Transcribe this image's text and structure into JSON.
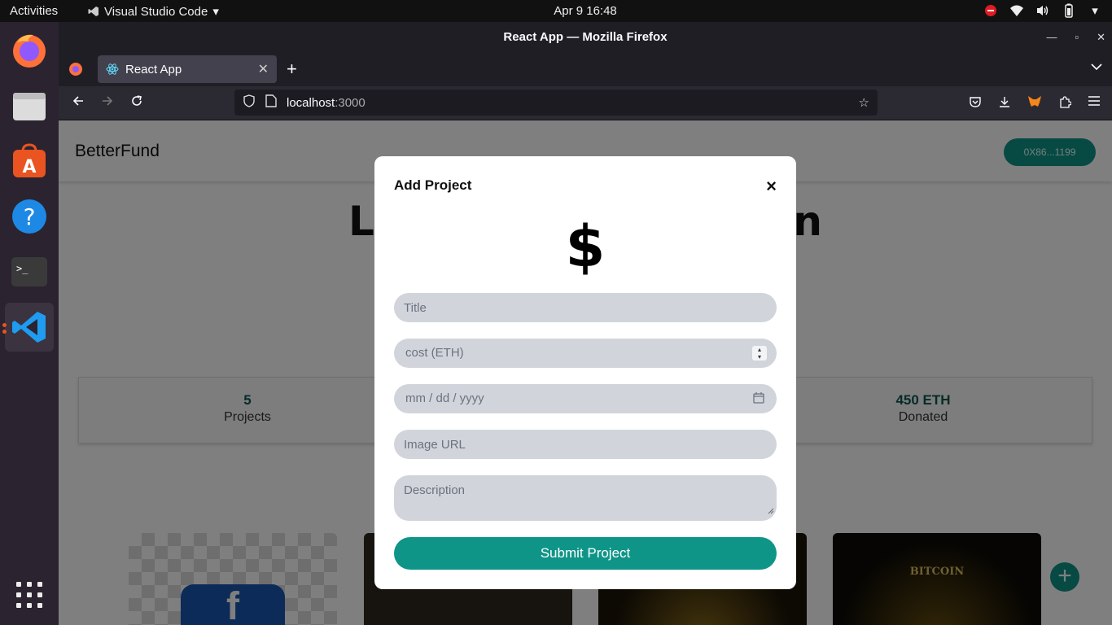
{
  "system": {
    "activities": "Activities",
    "app_menu": "Visual Studio Code",
    "clock": "Apr 9  16:48"
  },
  "browser": {
    "window_title": "React App — Mozilla Firefox",
    "tab_title": "React App",
    "url_host": "localhost",
    "url_port": ":3000"
  },
  "app": {
    "brand": "BetterFund",
    "wallet": "0X86...1199",
    "hero_left": "Lend",
    "hero_right": "ation",
    "stats": [
      {
        "value": "5",
        "label": "Projects"
      },
      {
        "value": "450 ETH",
        "label": "Donated"
      }
    ],
    "card_text": "BITCOIN"
  },
  "modal": {
    "title": "Add Project",
    "close": "×",
    "symbol": "$",
    "title_placeholder": "Title",
    "cost_placeholder": "cost (ETH)",
    "date_placeholder": "mm / dd / yyyy",
    "image_placeholder": "Image URL",
    "description_placeholder": "Description",
    "submit": "Submit Project"
  }
}
